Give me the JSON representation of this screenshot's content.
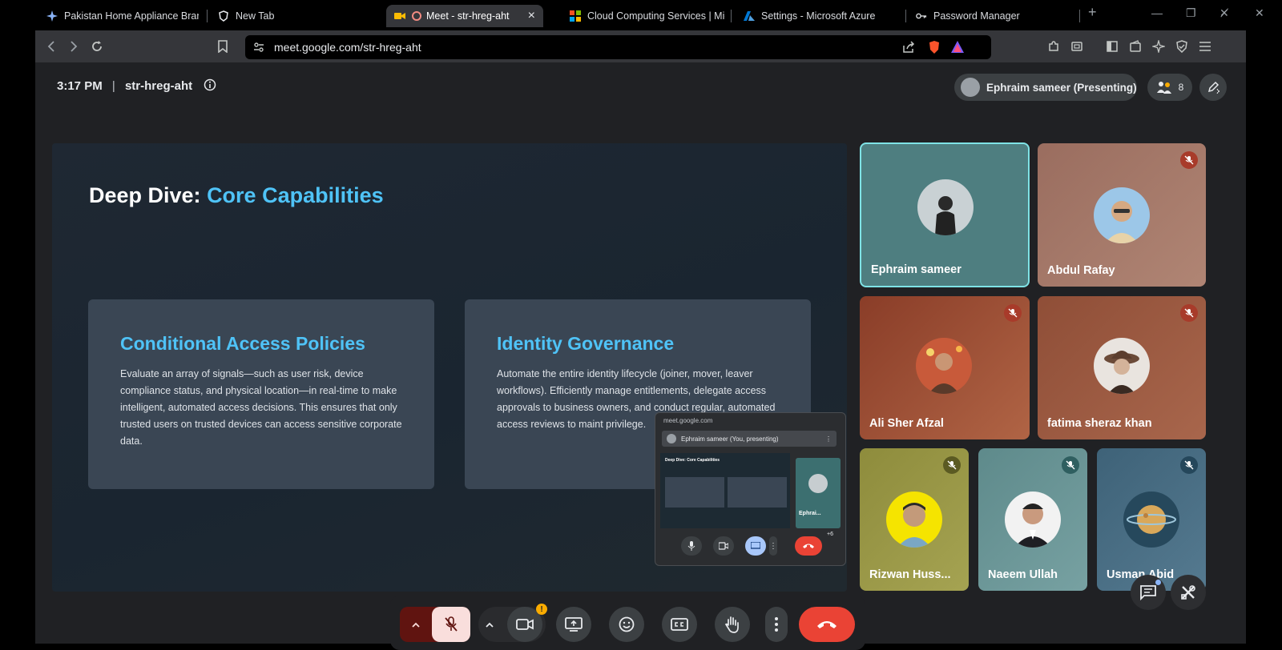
{
  "tabs": [
    {
      "label": "Pakistan Home Appliance Brands",
      "icon": "sparkle-icon"
    },
    {
      "label": "New Tab",
      "icon": "brave-shield-icon"
    },
    {
      "label": "Meet - str-hreg-aht",
      "icon": "meet-icon",
      "active": true
    },
    {
      "label": "Cloud Computing Services | Mic",
      "icon": "microsoft-icon"
    },
    {
      "label": "Settings - Microsoft Azure",
      "icon": "azure-icon"
    },
    {
      "label": "Password Manager",
      "icon": "key-icon"
    }
  ],
  "tab_close": "×",
  "new_tab": "+",
  "window_controls": {
    "minimize": "—",
    "maximize": "❐",
    "restore": "✕̸",
    "close": "✕"
  },
  "url": "meet.google.com/str-hreg-aht",
  "meeting": {
    "time": "3:17 PM",
    "separator": "|",
    "code": "str-hreg-aht",
    "presenter": "Ephraim sameer (Presenting)",
    "participant_count": "8"
  },
  "slide": {
    "title_prefix": "Deep Dive: ",
    "title_highlight": "Core Capabilities",
    "cards": [
      {
        "title": "Conditional Access Policies",
        "body": "Evaluate an array of signals—such as user risk, device compliance status, and physical location—in real-time to make intelligent, automated access decisions. This ensures that only trusted users on trusted devices can access sensitive corporate data."
      },
      {
        "title": "Identity Governance",
        "body": "Automate the entire identity lifecycle (joiner, mover, leaver workflows). Efficiently manage entitlements, delegate access approvals to business owners, and conduct regular, automated access reviews to maint privilege."
      }
    ]
  },
  "mini_preview": {
    "url": "meet.google.com",
    "bar": "Ephraim sameer (You, presenting)",
    "slide_title": "Deep Dive: Core Capabilities",
    "tile_name": "Ephrai...",
    "extra": "+6"
  },
  "participants": [
    {
      "name": "Ephraim sameer",
      "muted": false,
      "speaking": true
    },
    {
      "name": "Abdul Rafay",
      "muted": true
    },
    {
      "name": "Ali Sher Afzal",
      "muted": true
    },
    {
      "name": "fatima sheraz khan",
      "muted": true
    },
    {
      "name": "Rizwan Huss...",
      "muted": true
    },
    {
      "name": "Naeem Ullah",
      "muted": true
    },
    {
      "name": "Usman Abid",
      "muted": true
    }
  ],
  "colors": {
    "accent": "#4fc3f7",
    "end_call": "#ea4335",
    "speaking_border": "#7fe3e6",
    "mute_badge": "#a83b2a"
  }
}
